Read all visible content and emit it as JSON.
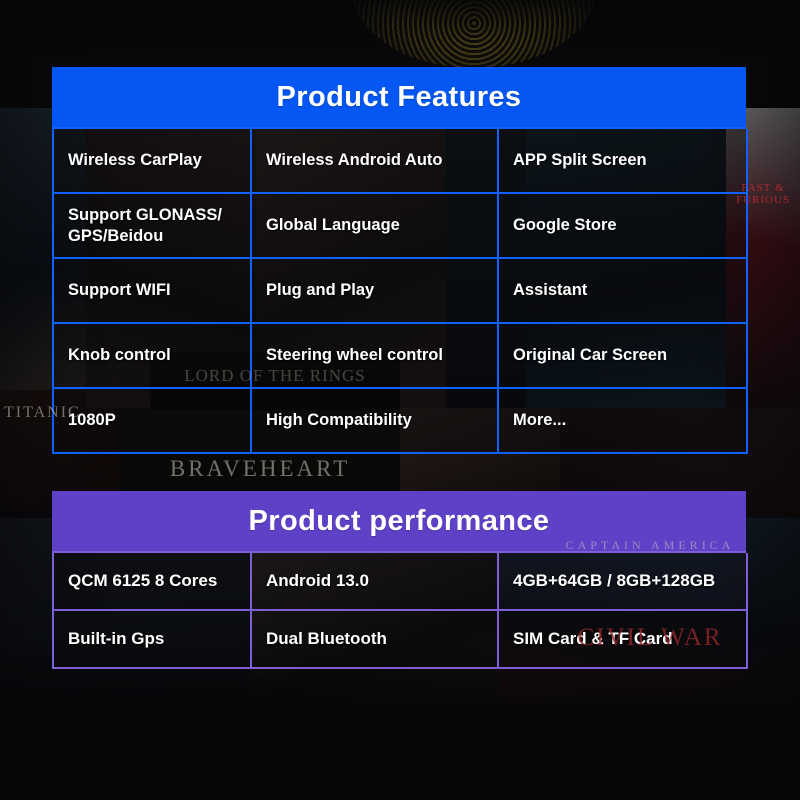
{
  "background": {
    "ornament": "concentric-rings",
    "posters": [
      {
        "label": "TITANIC"
      },
      {
        "label": "BRAVEHEART"
      },
      {
        "label": "CAPTAIN AMERICA"
      },
      {
        "label": "CIVIL WAR"
      },
      {
        "label": "LORD OF THE RINGS"
      },
      {
        "label": "FAST & FURIOUS"
      }
    ]
  },
  "colors": {
    "features_header": "#0457f2",
    "features_border": "#1161ff",
    "performance_header": "#5f41c8",
    "performance_border": "#7e5fd8",
    "text": "#ffffff",
    "page_background": "#08080a"
  },
  "features": {
    "title": "Product Features",
    "rows": [
      [
        "Wireless CarPlay",
        "Wireless Android Auto",
        "APP Split Screen"
      ],
      [
        "Support GLONASS/\nGPS/Beidou",
        "Global Language",
        "Google Store"
      ],
      [
        "Support WIFI",
        "Plug and Play",
        "Assistant"
      ],
      [
        "Knob control",
        "Steering wheel control",
        "Original Car Screen"
      ],
      [
        "1080P",
        "High Compatibility",
        "More..."
      ]
    ]
  },
  "performance": {
    "title": "Product performance",
    "rows": [
      [
        "QCM 6125 8 Cores",
        "Android 13.0",
        "4GB+64GB / 8GB+128GB"
      ],
      [
        "Built-in Gps",
        "Dual Bluetooth",
        "SIM Card & TF Card"
      ]
    ]
  }
}
